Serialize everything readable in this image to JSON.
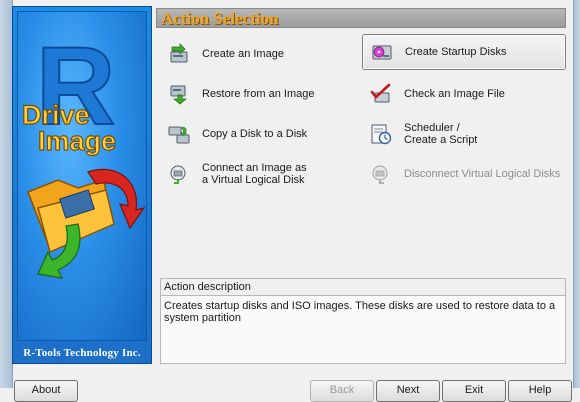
{
  "header": {
    "title": "Action Selection"
  },
  "brand": {
    "logo_letter": "R",
    "logo_word1": "Drive",
    "logo_word2": "Image",
    "footer": "R-Tools Technology Inc."
  },
  "actions": [
    {
      "label": "Create an Image",
      "icon": "create-image-icon",
      "selected": false,
      "enabled": true
    },
    {
      "label": "Create Startup Disks",
      "icon": "startup-disk-icon",
      "selected": true,
      "enabled": true
    },
    {
      "label": "Restore from an Image",
      "icon": "restore-image-icon",
      "selected": false,
      "enabled": true
    },
    {
      "label": "Check an Image File",
      "icon": "check-image-icon",
      "selected": false,
      "enabled": true
    },
    {
      "label": "Copy a Disk to a Disk",
      "icon": "copy-disk-icon",
      "selected": false,
      "enabled": true
    },
    {
      "label": "Scheduler /\nCreate a Script",
      "icon": "scheduler-icon",
      "selected": false,
      "enabled": true
    },
    {
      "label": "Connect an Image as\na Virtual Logical Disk",
      "icon": "connect-image-icon",
      "selected": false,
      "enabled": true
    },
    {
      "label": "Disconnect Virtual Logical Disks",
      "icon": "disconnect-disk-icon",
      "selected": false,
      "enabled": false
    }
  ],
  "description": {
    "title": "Action description",
    "text": "Creates startup disks and ISO images. These disks are used to restore data to a system partition"
  },
  "buttons": [
    {
      "label": "About",
      "enabled": true
    },
    {
      "label": "Back",
      "enabled": false
    },
    {
      "label": "Next",
      "enabled": true
    },
    {
      "label": "Exit",
      "enabled": true
    },
    {
      "label": "Help",
      "enabled": true
    }
  ],
  "colors": {
    "header_text": "#f0a428",
    "brand_blue": "#1b7fd8",
    "selected_border": "#7a7a7a"
  }
}
